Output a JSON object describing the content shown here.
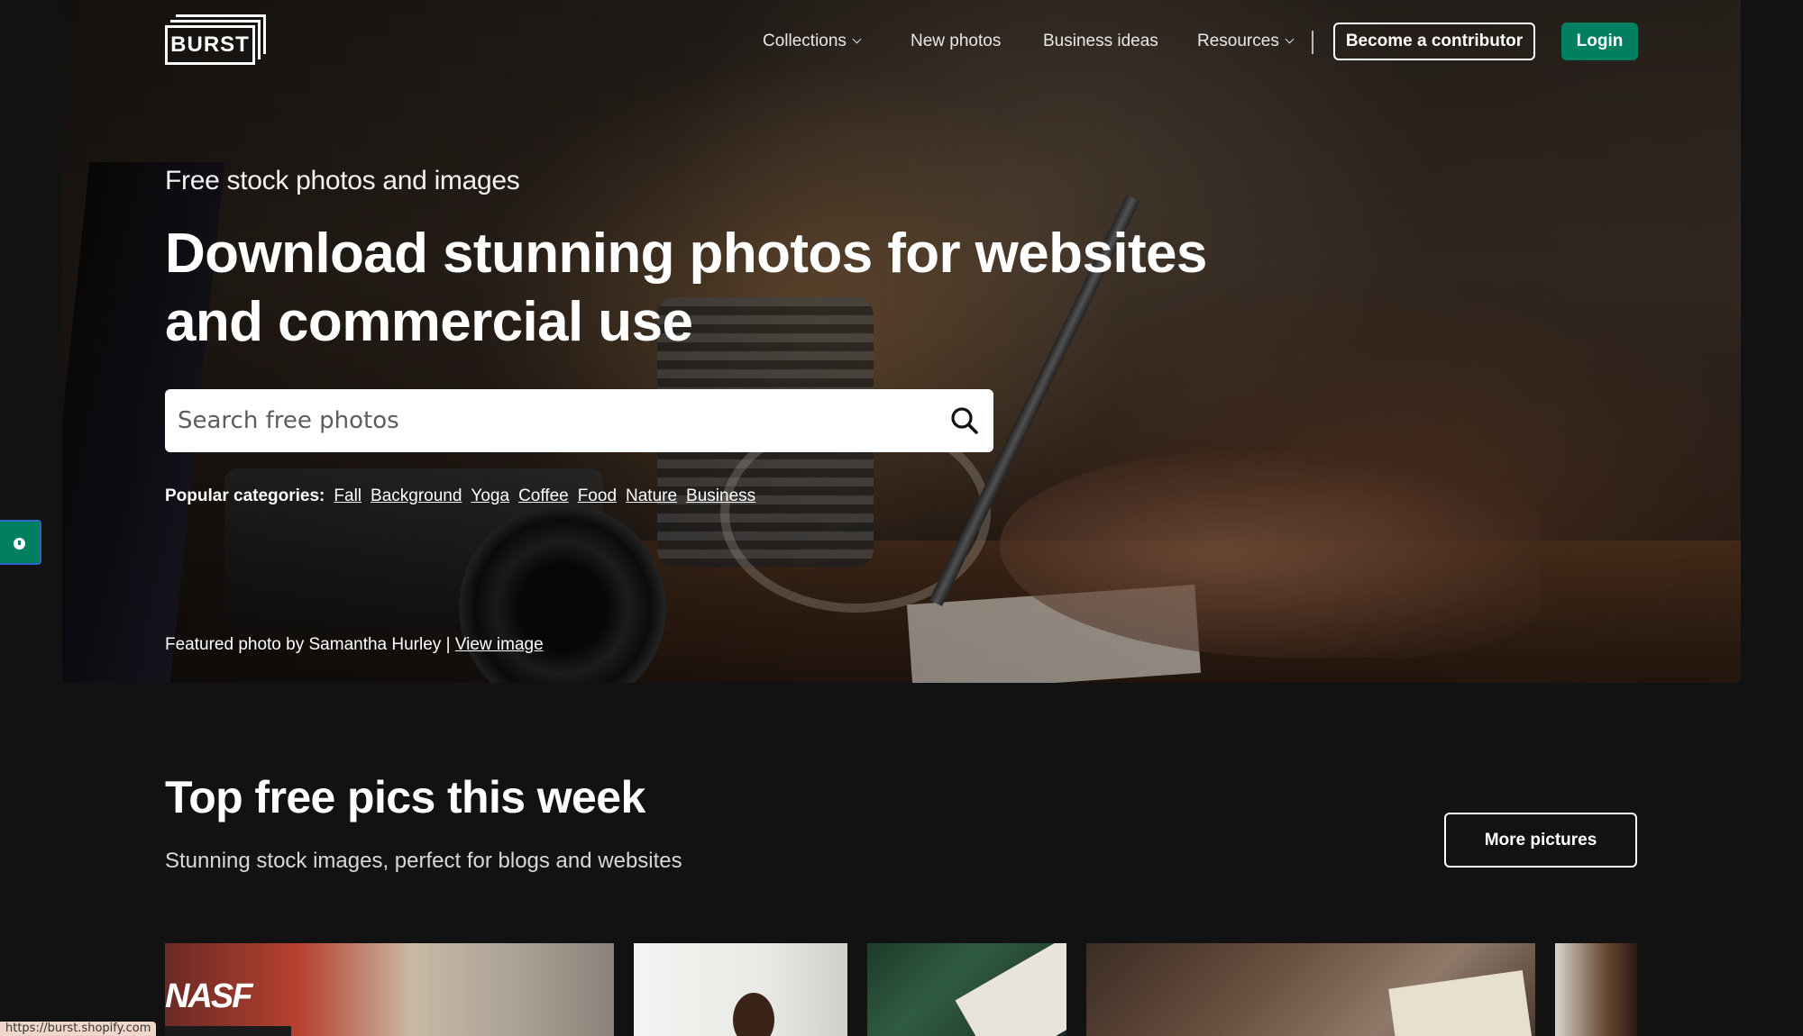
{
  "brand": {
    "logo_text": "BURST"
  },
  "nav": {
    "items": [
      {
        "label": "Collections",
        "has_dropdown": true
      },
      {
        "label": "New photos",
        "has_dropdown": false
      },
      {
        "label": "Business ideas",
        "has_dropdown": false
      },
      {
        "label": "Resources",
        "has_dropdown": true
      }
    ],
    "contributor_label": "Become a contributor",
    "login_label": "Login"
  },
  "hero": {
    "eyebrow": "Free stock photos and images",
    "headline": "Download stunning photos for websites and commercial use",
    "search_placeholder": "Search free photos",
    "popular_label": "Popular categories:",
    "categories": [
      "Fall",
      "Background",
      "Yoga",
      "Coffee",
      "Food",
      "Nature",
      "Business"
    ],
    "featured_prefix": "Featured photo by Samantha Hurley |",
    "featured_link": "View image"
  },
  "section": {
    "title": "Top free pics this week",
    "subtitle": "Stunning stock images, perfect for blogs and websites",
    "more_label": "More pictures"
  },
  "thumbnails": [
    {
      "sign_text": "NASF"
    }
  ],
  "status_bar": {
    "url": "https://burst.shopify.com"
  },
  "colors": {
    "brand_green": "#008060",
    "background": "#121212"
  }
}
